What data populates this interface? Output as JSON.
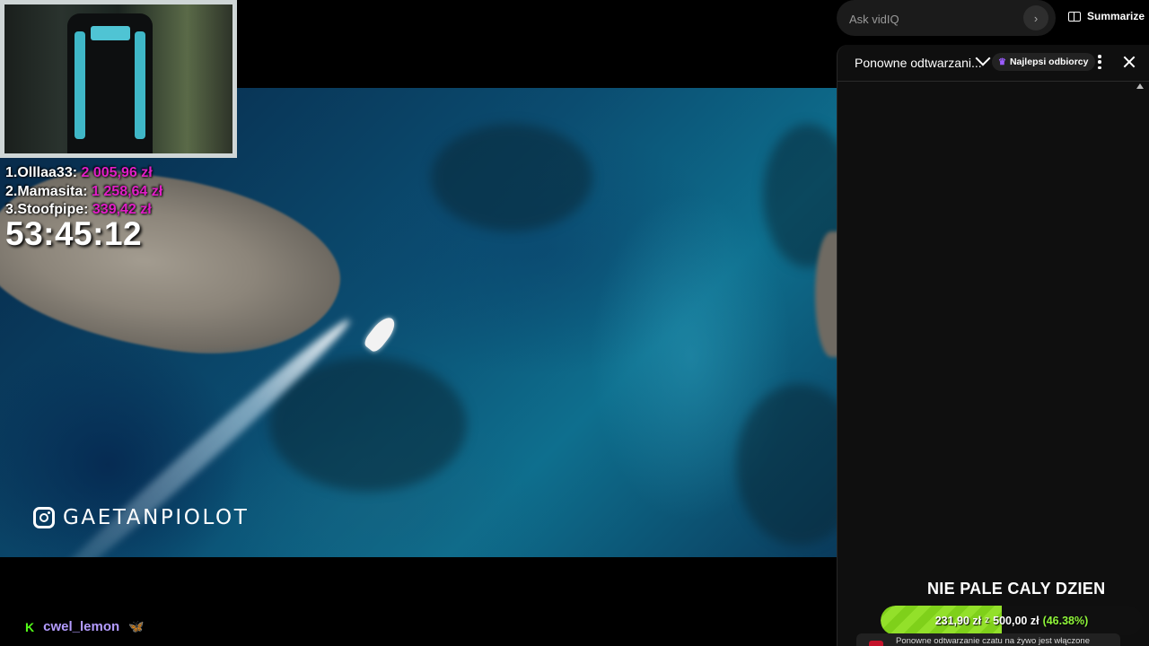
{
  "leaderboard": [
    {
      "rank": "1.",
      "name": "Olllaa33:",
      "amount": "2 005,96 zł"
    },
    {
      "rank": "2.",
      "name": "Mamasita:",
      "amount": "1 258,64 zł"
    },
    {
      "rank": "3.",
      "name": "Stoofpipe:",
      "amount": "339,42 zł"
    }
  ],
  "timer": "53:45:12",
  "watermark": {
    "text": "GAETANPIOLOT",
    "icon": "instagram-icon"
  },
  "user_line": {
    "icon": "kick-logo-icon",
    "icon_glyph": "K",
    "name": "cwel_lemon",
    "emote": "🦋"
  },
  "ask": {
    "placeholder": "Ask vidIQ",
    "go_glyph": "›"
  },
  "summarize": {
    "label": "Summarize",
    "icon": "book-icon"
  },
  "chat": {
    "mode_label": "Ponowne odtwarzani...",
    "top_fans_label": "Najlepsi odbiorcy",
    "crown_glyph": "♛"
  },
  "goal": {
    "title": "NIE PALE CALY DZIEN",
    "current": "231,90 zł",
    "of": "z",
    "target": "500,00 zł",
    "percent_label": "(46.38%)",
    "progress": 0.4638,
    "fill_color": "#7fd01a"
  },
  "replay_notice": "Ponowne odtwarzanie czatu na żywo jest włączone"
}
